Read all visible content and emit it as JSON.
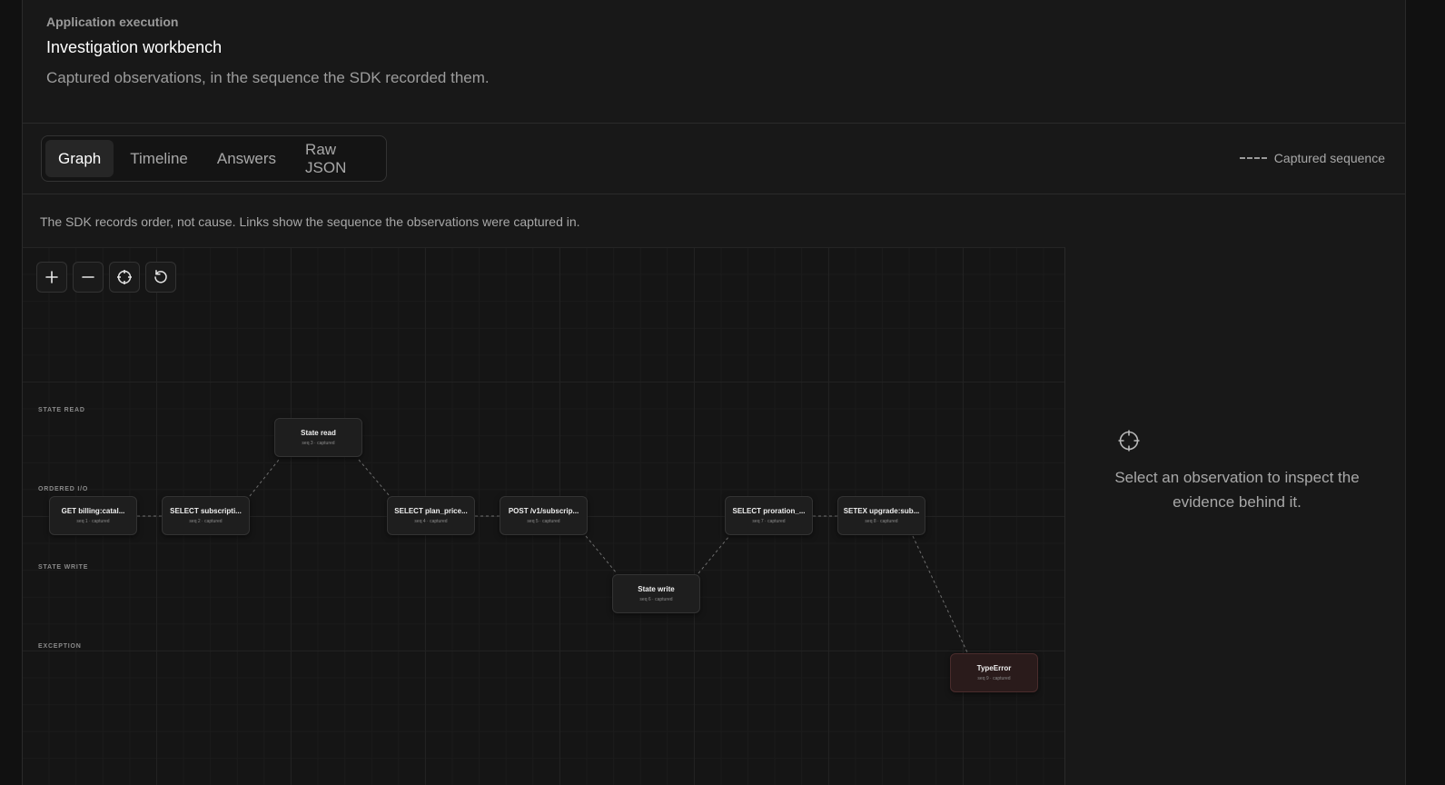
{
  "header": {
    "eyebrow": "Application execution",
    "title": "Investigation workbench",
    "subtitle": "Captured observations, in the sequence the SDK recorded them."
  },
  "tabs": [
    {
      "label": "Graph",
      "active": true
    },
    {
      "label": "Timeline",
      "active": false
    },
    {
      "label": "Answers",
      "active": false
    },
    {
      "label": "Raw JSON",
      "active": false
    }
  ],
  "legend": {
    "label": "Captured sequence"
  },
  "note": "The SDK records order, not cause. Links show the sequence the observations were captured in.",
  "controls": {
    "zoom_in": "plus-icon",
    "zoom_out": "minus-icon",
    "fit": "crosshair-icon",
    "reset": "rotate-icon"
  },
  "lanes": [
    "STATE READ",
    "ORDERED I/O",
    "STATE WRITE",
    "EXCEPTION"
  ],
  "nodes": [
    {
      "label": "GET billing:catal...",
      "meta": "seq 1 · captured"
    },
    {
      "label": "SELECT subscripti...",
      "meta": "seq 2 · captured"
    },
    {
      "label": "State read",
      "meta": "seq 3 · captured"
    },
    {
      "label": "SELECT plan_price...",
      "meta": "seq 4 · captured"
    },
    {
      "label": "POST /v1/subscrip...",
      "meta": "seq 5 · captured"
    },
    {
      "label": "State write",
      "meta": "seq 6 · captured"
    },
    {
      "label": "SELECT proration_...",
      "meta": "seq 7 · captured"
    },
    {
      "label": "SETEX upgrade:sub...",
      "meta": "seq 8 · captured"
    },
    {
      "label": "TypeError",
      "meta": "seq 9 · captured"
    }
  ],
  "inspector": {
    "icon": "crosshair-icon",
    "message": "Select an observation to inspect the evidence behind it."
  },
  "colors": {
    "background": "#111111",
    "panel": "#181818",
    "edge": "#6e6e6e",
    "error_node": "#2a1b1b"
  }
}
